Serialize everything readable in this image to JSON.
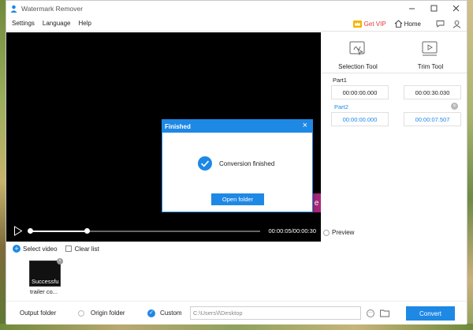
{
  "window": {
    "title": "Watermark Remover"
  },
  "menu": {
    "items": [
      "Settings",
      "Language",
      "Help"
    ],
    "vip_label": "Get VIP",
    "home_label": "Home"
  },
  "player": {
    "time_display": "00:00:05/00:00:30",
    "progress_fraction": 0.25,
    "overlay_letter": "e"
  },
  "tools": {
    "selection_label": "Selection Tool",
    "trim_label": "Trim Tool"
  },
  "parts": [
    {
      "label": "Part1",
      "start": "00:00:00.000",
      "end": "00:00:30.030"
    },
    {
      "label": "Part2",
      "start": "00:00:00.000",
      "end": "00:00:07.507"
    }
  ],
  "preview_label": "Preview",
  "file_bar": {
    "select_video": "Select video",
    "clear_list": "Clear list"
  },
  "thumbnail": {
    "status": "Successfu",
    "name": "trailer co..."
  },
  "bottom": {
    "output_folder_label": "Output folder",
    "origin_folder_label": "Origin folder",
    "custom_label": "Custom",
    "path_value": "C:\\Users\\l\\Desktop",
    "more_label": "···",
    "convert_label": "Convert"
  },
  "dialog": {
    "title": "Finished",
    "message": "Conversion finished",
    "open_folder_label": "Open folder"
  },
  "colors": {
    "accent": "#1e88e5",
    "vip": "#e4393c",
    "part2": "#1e88e5"
  },
  "icons": {
    "app": "person-icon",
    "vip": "crown-icon",
    "home": "home-icon",
    "feedback": "chat-icon",
    "account": "user-icon"
  }
}
